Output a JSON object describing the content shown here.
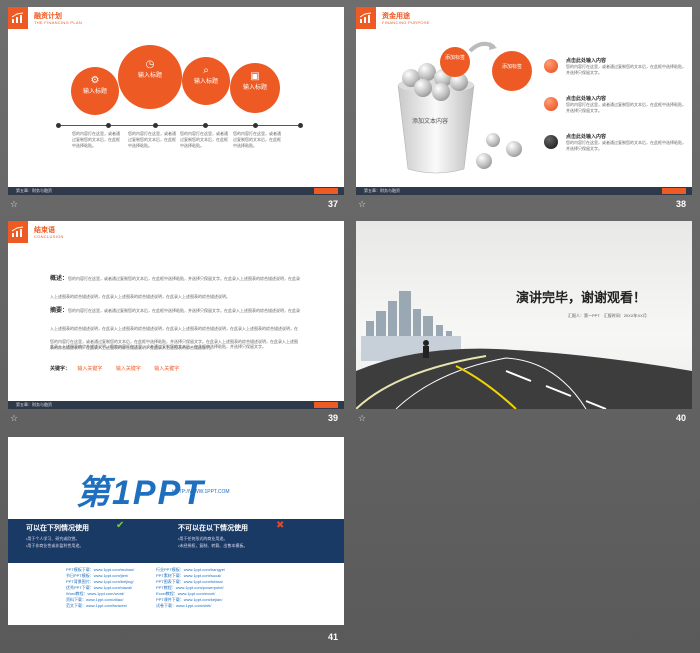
{
  "slide37": {
    "title": "融资计划",
    "subtitle": "THE FINANCING PLAN",
    "circles": [
      "输入标题",
      "输入标题",
      "输入标题",
      "输入标题"
    ],
    "descriptions": [
      "您的内容打在这里，或者通过复制您的文本后，在此框中选择粘贴。",
      "您的内容打在这里，或者通过复制您的文本后，在此框中选择粘贴。",
      "您的内容打在这里，或者通过复制您的文本后，在此框中选择粘贴。",
      "您的内容打在这里，或者通过复制您的文本后，在此框中选择粘贴。"
    ],
    "footer": "第五章：财务与融资",
    "page": "37"
  },
  "slide38": {
    "title": "资金用途",
    "subtitle": "FINANCING PURPOSE",
    "cup_text": "添加文本内容",
    "label_a": "添加标签",
    "label_b": "添加标签",
    "items": [
      {
        "title": "点击此处输入内容",
        "text": "您的内容打在这里，或者通过复制您的文本后，在此框中选择粘贴，并选择只保留文字。"
      },
      {
        "title": "点击此处输入内容",
        "text": "您的内容打在这里，或者通过复制您的文本后，在此框中选择粘贴，并选择只保留文字。"
      },
      {
        "title": "点击此处输入内容",
        "text": "您的内容打在这里，或者通过复制您的文本后，在此框中选择粘贴，并选择只保留文字。"
      }
    ],
    "footer": "第五章：财务与融资",
    "page": "38"
  },
  "slide39": {
    "title": "结束语",
    "subtitle": "CONCLUSION",
    "summary_label": "概述：",
    "summary_text": "您的内容打在这里，或者通过复制您的文本后，在此框中选择粘贴，并选择只保留文字。在此录入上述图表的综合描述说明，在此录入上述图表的综合描述说明，在此录入上述图表的综合描述说明，在此录入上述图表的综合描述说明。",
    "abstract_label": "摘要：",
    "abstract_text": "您的内容打在这里，或者通过复制您的文本后，在此框中选择粘贴，并选择只保留文字。在此录入上述图表的综合描述说明，在此录入上述图表的综合描述说明，在此录入上述图表的综合描述说明，在此录入上述图表的综合描述说明，在此录入上述图表的综合描述说明，在此录入上述图表的综合描述说明。您的内容打在这里，或者通过复制您的文本后，在此框中选择粘贴，并选择只保留文字。",
    "extra_text": "您的内容打在这里，或者通过复制您的文本后，在此框中选择粘贴，并选择只保留文字。在此录入上述图表的综合描述说明，在此录入上述图表的综合描述说明，在此录入上述图表的综合描述说明，在此录入上述图表的综合描述说明。",
    "keywords_label": "关键字：",
    "keywords": [
      "输入关键字",
      "输入关键字",
      "输入关键字"
    ],
    "footer": "第五章：财务与融资",
    "page": "39"
  },
  "slide40": {
    "title": "演讲完毕，谢谢观看！",
    "meta": "汇报人：第一PPT　汇报时间：20XX年XX月",
    "page": "40"
  },
  "slide41": {
    "logo_main": "第1PPT",
    "logo_url": "HTTP://WWW.1PPT.COM",
    "can_title": "可以在下列情况使用",
    "can_items": [
      "•用于个人学习、研究或欣赏。",
      "•用于非商业性或非盈利性用途。"
    ],
    "cannot_title": "不可以在以下情况使用",
    "cannot_items": [
      "•用于任何形式的商业用途。",
      "•未经授权，复制、转载、出售本模板。"
    ],
    "links_left": [
      "PPT模板下载：www.1ppt.com/moban/",
      "节日PPT模板：www.1ppt.com/jieri/",
      "PPT背景图片：www.1ppt.com/beijing/",
      "优秀PPT下载：www.1ppt.com/xiazai/",
      "Word教程：www.1ppt.com/word/",
      "资料下载：www.1ppt.com/ziliao/",
      "范文下载：www.1ppt.com/fanwen/"
    ],
    "links_right": [
      "行业PPT模板：www.1ppt.com/hangye/",
      "PPT素材下载：www.1ppt.com/sucai/",
      "PPT图表下载：www.1ppt.com/tubiao/",
      "PPT教程：www.1ppt.com/powerpoint/",
      "Excel教程：www.1ppt.com/excel/",
      "PPT课件下载：www.1ppt.com/kejian/",
      "试卷下载：www.1ppt.com/shiti/"
    ],
    "page": "41"
  },
  "star": "☆"
}
